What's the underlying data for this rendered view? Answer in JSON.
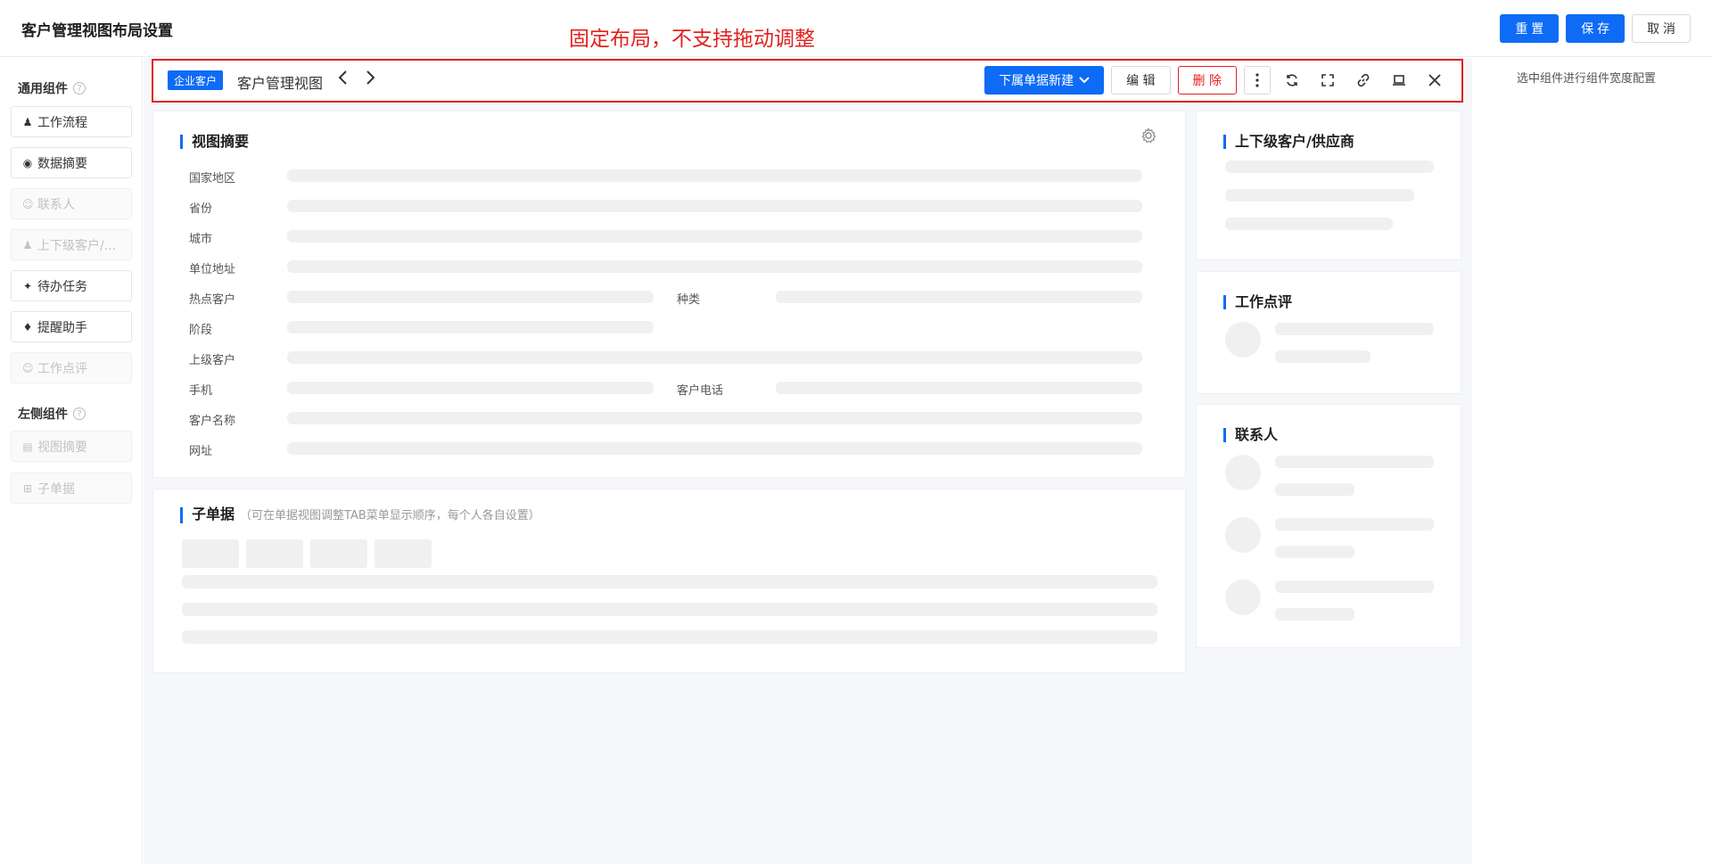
{
  "app": {
    "title": "客户管理视图布局设置",
    "annotation": "固定布局，不支持拖动调整",
    "actions": {
      "reset": "重 置",
      "save": "保 存",
      "cancel": "取 消"
    }
  },
  "left": {
    "general_title": "通用组件",
    "general_items": [
      {
        "label": "工作流程",
        "icon": "user-flow-icon",
        "disabled": false
      },
      {
        "label": "数据摘要",
        "icon": "target-icon",
        "disabled": false
      },
      {
        "label": "联系人",
        "icon": "person-icon",
        "disabled": true
      },
      {
        "label": "上下级客户/...",
        "icon": "org-icon",
        "disabled": true
      },
      {
        "label": "待办任务",
        "icon": "pin-icon",
        "disabled": false
      },
      {
        "label": "提醒助手",
        "icon": "bell-icon",
        "disabled": false
      },
      {
        "label": "工作点评",
        "icon": "smile-icon",
        "disabled": true
      }
    ],
    "side_title": "左侧组件",
    "side_items": [
      {
        "label": "视图摘要",
        "icon": "document-icon",
        "disabled": true
      },
      {
        "label": "子单据",
        "icon": "grid-icon",
        "disabled": true
      }
    ]
  },
  "header": {
    "tag": "企业客户",
    "title": "客户管理视图",
    "new_sub": "下属单据新建",
    "edit": "编 辑",
    "delete": "删 除"
  },
  "summary": {
    "title": "视图摘要",
    "fields": [
      "国家地区",
      "省份",
      "城市",
      "单位地址",
      "热点客户",
      "种类",
      "阶段",
      "上级客户",
      "手机",
      "客户电话",
      "客户名称",
      "网址"
    ]
  },
  "subdocs": {
    "title": "子单据",
    "hint": "（可在单据视图调整TAB菜单显示顺序，每个人各自设置）"
  },
  "side_cards": {
    "hierarchy": "上下级客户/供应商",
    "review": "工作点评",
    "contacts": "联系人"
  },
  "right": {
    "hint": "选中组件进行组件宽度配置"
  },
  "colors": {
    "primary": "#0d6bf5",
    "danger": "#e0221e",
    "canvas": "#f5f7fa"
  }
}
